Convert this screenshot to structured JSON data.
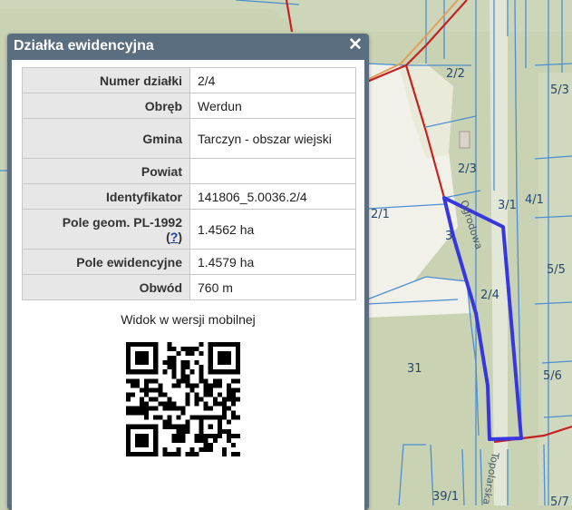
{
  "map": {
    "parcel_labels": [
      "2/2",
      "2/3",
      "3/1",
      "4/1",
      "5/3",
      "2/1",
      "3",
      "5/5",
      "2/4",
      "31",
      "5/6",
      "39/1",
      "5/7"
    ],
    "street_labels": [
      "Ogrodowa",
      "Topolarska"
    ],
    "selected_parcel": "2/4",
    "colors": {
      "background": "#c9d3b3",
      "parcel_border": "#4d8fd1",
      "road": "#c62121",
      "selection": "#3737e0",
      "white_area": "#f2f1e9"
    }
  },
  "popup": {
    "title": "Działka ewidencyjna",
    "close_icon": "close-icon",
    "rows": [
      {
        "label": "Numer działki",
        "value": "2/4"
      },
      {
        "label": "Obręb",
        "value": "Werdun"
      },
      {
        "label": "Gmina",
        "value": "Tarczyn - obszar wiejski"
      },
      {
        "label": "Powiat",
        "value": ""
      },
      {
        "label": "Identyfikator",
        "value": "141806_5.0036.2/4"
      },
      {
        "label": "Pole geom. PL-1992",
        "value": "1.4562 ha"
      },
      {
        "label": "Pole ewidencyjne",
        "value": "1.4579 ha"
      },
      {
        "label": "Obwód",
        "value": "760 m"
      }
    ],
    "help_link": "?",
    "mobile_label": "Widok w wersji mobilnej",
    "qr_icon": "qr-code-icon"
  }
}
